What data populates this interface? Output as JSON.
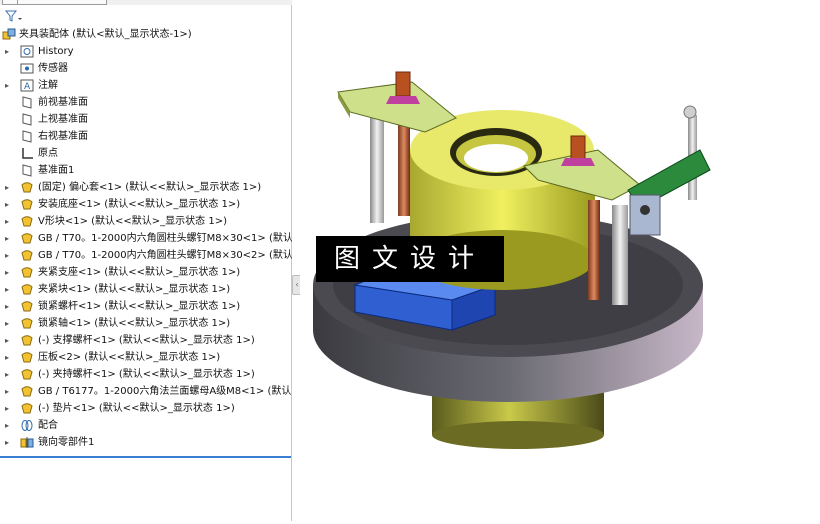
{
  "feature_tree": {
    "root": "夹具装配体  (默认<默认_显示状态-1>)",
    "items": [
      {
        "label": "History",
        "icon": "history-icon",
        "arrow": true
      },
      {
        "label": "传感器",
        "icon": "sensor-icon",
        "arrow": false
      },
      {
        "label": "注解",
        "icon": "annotation-icon",
        "arrow": true
      },
      {
        "label": "前视基准面",
        "icon": "plane-icon",
        "arrow": false
      },
      {
        "label": "上视基准面",
        "icon": "plane-icon",
        "arrow": false
      },
      {
        "label": "右视基准面",
        "icon": "plane-icon",
        "arrow": false
      },
      {
        "label": "原点",
        "icon": "origin-icon",
        "arrow": false
      },
      {
        "label": "基准面1",
        "icon": "plane-icon",
        "arrow": false
      },
      {
        "label": "(固定) 偏心套<1> (默认<<默认>_显示状态 1>)",
        "icon": "part-icon",
        "arrow": true
      },
      {
        "label": "安装底座<1> (默认<<默认>_显示状态 1>)",
        "icon": "part-icon",
        "arrow": true
      },
      {
        "label": "V形块<1> (默认<<默认>_显示状态 1>)",
        "icon": "part-icon",
        "arrow": true
      },
      {
        "label": "GB / T70。1-2000内六角圆柱头螺钉M8×30<1> (默认<<默",
        "icon": "part-icon",
        "arrow": true
      },
      {
        "label": "GB / T70。1-2000内六角圆柱头螺钉M8×30<2> (默认<<默",
        "icon": "part-icon",
        "arrow": true
      },
      {
        "label": "夹紧支座<1> (默认<<默认>_显示状态 1>)",
        "icon": "part-icon",
        "arrow": true
      },
      {
        "label": "夹紧块<1> (默认<<默认>_显示状态 1>)",
        "icon": "part-icon",
        "arrow": true
      },
      {
        "label": "锁紧螺杆<1> (默认<<默认>_显示状态 1>)",
        "icon": "part-icon",
        "arrow": true
      },
      {
        "label": "锁紧轴<1> (默认<<默认>_显示状态 1>)",
        "icon": "part-icon",
        "arrow": true
      },
      {
        "label": "(-) 支撑螺杆<1> (默认<<默认>_显示状态 1>)",
        "icon": "part-icon",
        "arrow": true
      },
      {
        "label": "压板<2> (默认<<默认>_显示状态 1>)",
        "icon": "part-icon",
        "arrow": true
      },
      {
        "label": "(-) 夹持螺杆<1> (默认<<默认>_显示状态 1>)",
        "icon": "part-icon",
        "arrow": true
      },
      {
        "label": "GB / T6177。1-2000六角法兰面螺母A级M8<1> (默认<<默",
        "icon": "part-icon",
        "arrow": true
      },
      {
        "label": "(-) 垫片<1> (默认<<默认>_显示状态 1>)",
        "icon": "part-icon",
        "arrow": true
      },
      {
        "label": "配合",
        "icon": "mate-icon",
        "arrow": true
      },
      {
        "label": "镜向零部件1",
        "icon": "mirror-icon",
        "arrow": true
      }
    ]
  },
  "watermark": "图文设计",
  "colors": {
    "selection_line": "#3a7fd0",
    "part_yellow": "#f2c230"
  }
}
